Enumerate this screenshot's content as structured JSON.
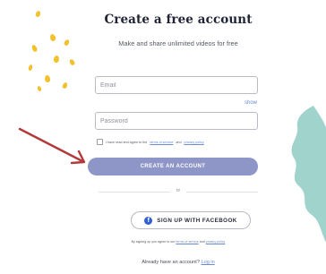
{
  "signup": {
    "title": "Create a free account",
    "subtitle": "Make and share unlimited videos for free",
    "email_placeholder": "Email",
    "show_link": "show",
    "password_placeholder": "Password",
    "terms_prefix": "I have read and agree to the",
    "terms_link": "terms of service",
    "terms_and": "and",
    "privacy_link": "privacy policy",
    "create_button": "CREATE AN ACCOUNT",
    "or_text": "or",
    "facebook_button": "SIGN UP WITH FACEBOOK",
    "fine_print_prefix": "By signing up you agree to our",
    "fine_print_terms": "terms of service",
    "fine_print_and": "and",
    "fine_print_privacy": "privacy policy",
    "login_prompt": "Already have an account?",
    "login_link": "Log in"
  },
  "colors": {
    "primary_button": "#8e95c7",
    "facebook_blue": "#2f5fd0",
    "accent_dots": "#f2c12e",
    "blob_teal": "#9fd3cc",
    "arrow_red": "#b23a3a",
    "link": "#6a8bd0"
  },
  "icons": {
    "facebook": "facebook-f-icon"
  }
}
